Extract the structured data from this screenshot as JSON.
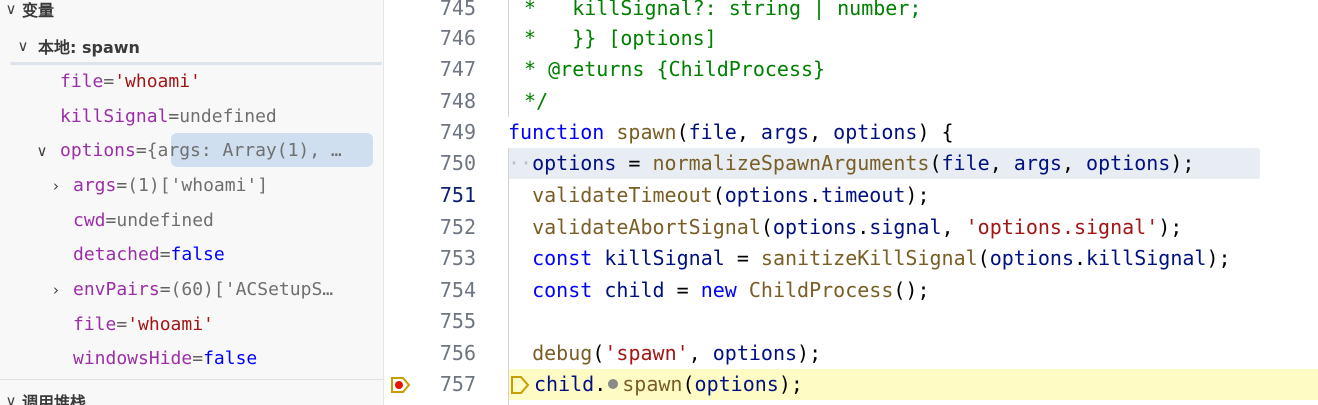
{
  "sidebar": {
    "variables_header": "变量",
    "scope_header": "本地: spawn",
    "call_stack_header": "调用堆栈",
    "vars": {
      "file": {
        "name": "file",
        "eq": " = ",
        "value": "'whoami'"
      },
      "killSignal": {
        "name": "killSignal",
        "eq": " = ",
        "value": "undefined"
      },
      "options": {
        "name": "options",
        "eq": " = ",
        "value": "{args: Array(1), …"
      },
      "args": {
        "name": "args",
        "eq": " = ",
        "count": "(1) ",
        "value": "['whoami']"
      },
      "cwd": {
        "name": "cwd",
        "eq": " = ",
        "value": "undefined"
      },
      "detached": {
        "name": "detached",
        "eq": " = ",
        "value": "false"
      },
      "envPairs": {
        "name": "envPairs",
        "eq": " = ",
        "count": "(60) ",
        "value": "['ACSetupS…"
      },
      "file2": {
        "name": "file",
        "eq": " = ",
        "value": "'whoami'"
      },
      "windowsHide": {
        "name": "windowsHide",
        "eq": " = ",
        "value": "false"
      }
    }
  },
  "editor": {
    "line_numbers": [
      "745",
      "746",
      "747",
      "748",
      "749",
      "750",
      "751",
      "752",
      "753",
      "754",
      "755",
      "756",
      "757"
    ],
    "active_line": "751",
    "paused_line": "757",
    "lines": {
      "l745": {
        "text": " *   killSignal?: string | number;"
      },
      "l746": {
        "text": " *   }} [options]"
      },
      "l747": {
        "text": " * @returns {ChildProcess}"
      },
      "l748": {
        "text": " */"
      },
      "l749": {
        "kw": "function",
        "fn": "spawn",
        "p1": "(",
        "a1": "file",
        "c1": ", ",
        "a2": "args",
        "c2": ", ",
        "a3": "options",
        "p2": ") {"
      },
      "l750": {
        "indent": "··",
        "v": "options",
        "eq": " = ",
        "fn": "normalizeSpawnArguments",
        "p1": "(",
        "a1": "file",
        "c1": ", ",
        "a2": "args",
        "c2": ", ",
        "a3": "options",
        "p2": ");"
      },
      "l751": {
        "fn": "validateTimeout",
        "p1": "(",
        "v": "options",
        "dot": ".",
        "prop": "timeout",
        "p2": ");"
      },
      "l752": {
        "fn": "validateAbortSignal",
        "p1": "(",
        "v": "options",
        "dot": ".",
        "prop": "signal",
        "c": ", ",
        "str": "'options.signal'",
        "p2": ");"
      },
      "l753": {
        "kw": "const",
        "v": "killSignal",
        "eq": " = ",
        "fn": "sanitizeKillSignal",
        "p1": "(",
        "a": "options",
        "dot": ".",
        "prop": "killSignal",
        "p2": ");"
      },
      "l754": {
        "kw": "const",
        "v": "child",
        "eq": " = ",
        "kw2": "new",
        "fn": "ChildProcess",
        "p": "();"
      },
      "l756": {
        "fn": "debug",
        "p1": "(",
        "str": "'spawn'",
        "c": ", ",
        "a": "options",
        "p2": ");"
      },
      "l757": {
        "v": "child",
        "dot": ".",
        "fn": "spawn",
        "p1": "(",
        "a": "options",
        "p2": ");"
      }
    }
  },
  "colors": {
    "panel_bg": "#f8f8f8",
    "selection": "#cfdff0",
    "current_line_highlight": "#fffbc5",
    "breakpoint": "#e51400",
    "paused_arrow": "#c69e00"
  }
}
